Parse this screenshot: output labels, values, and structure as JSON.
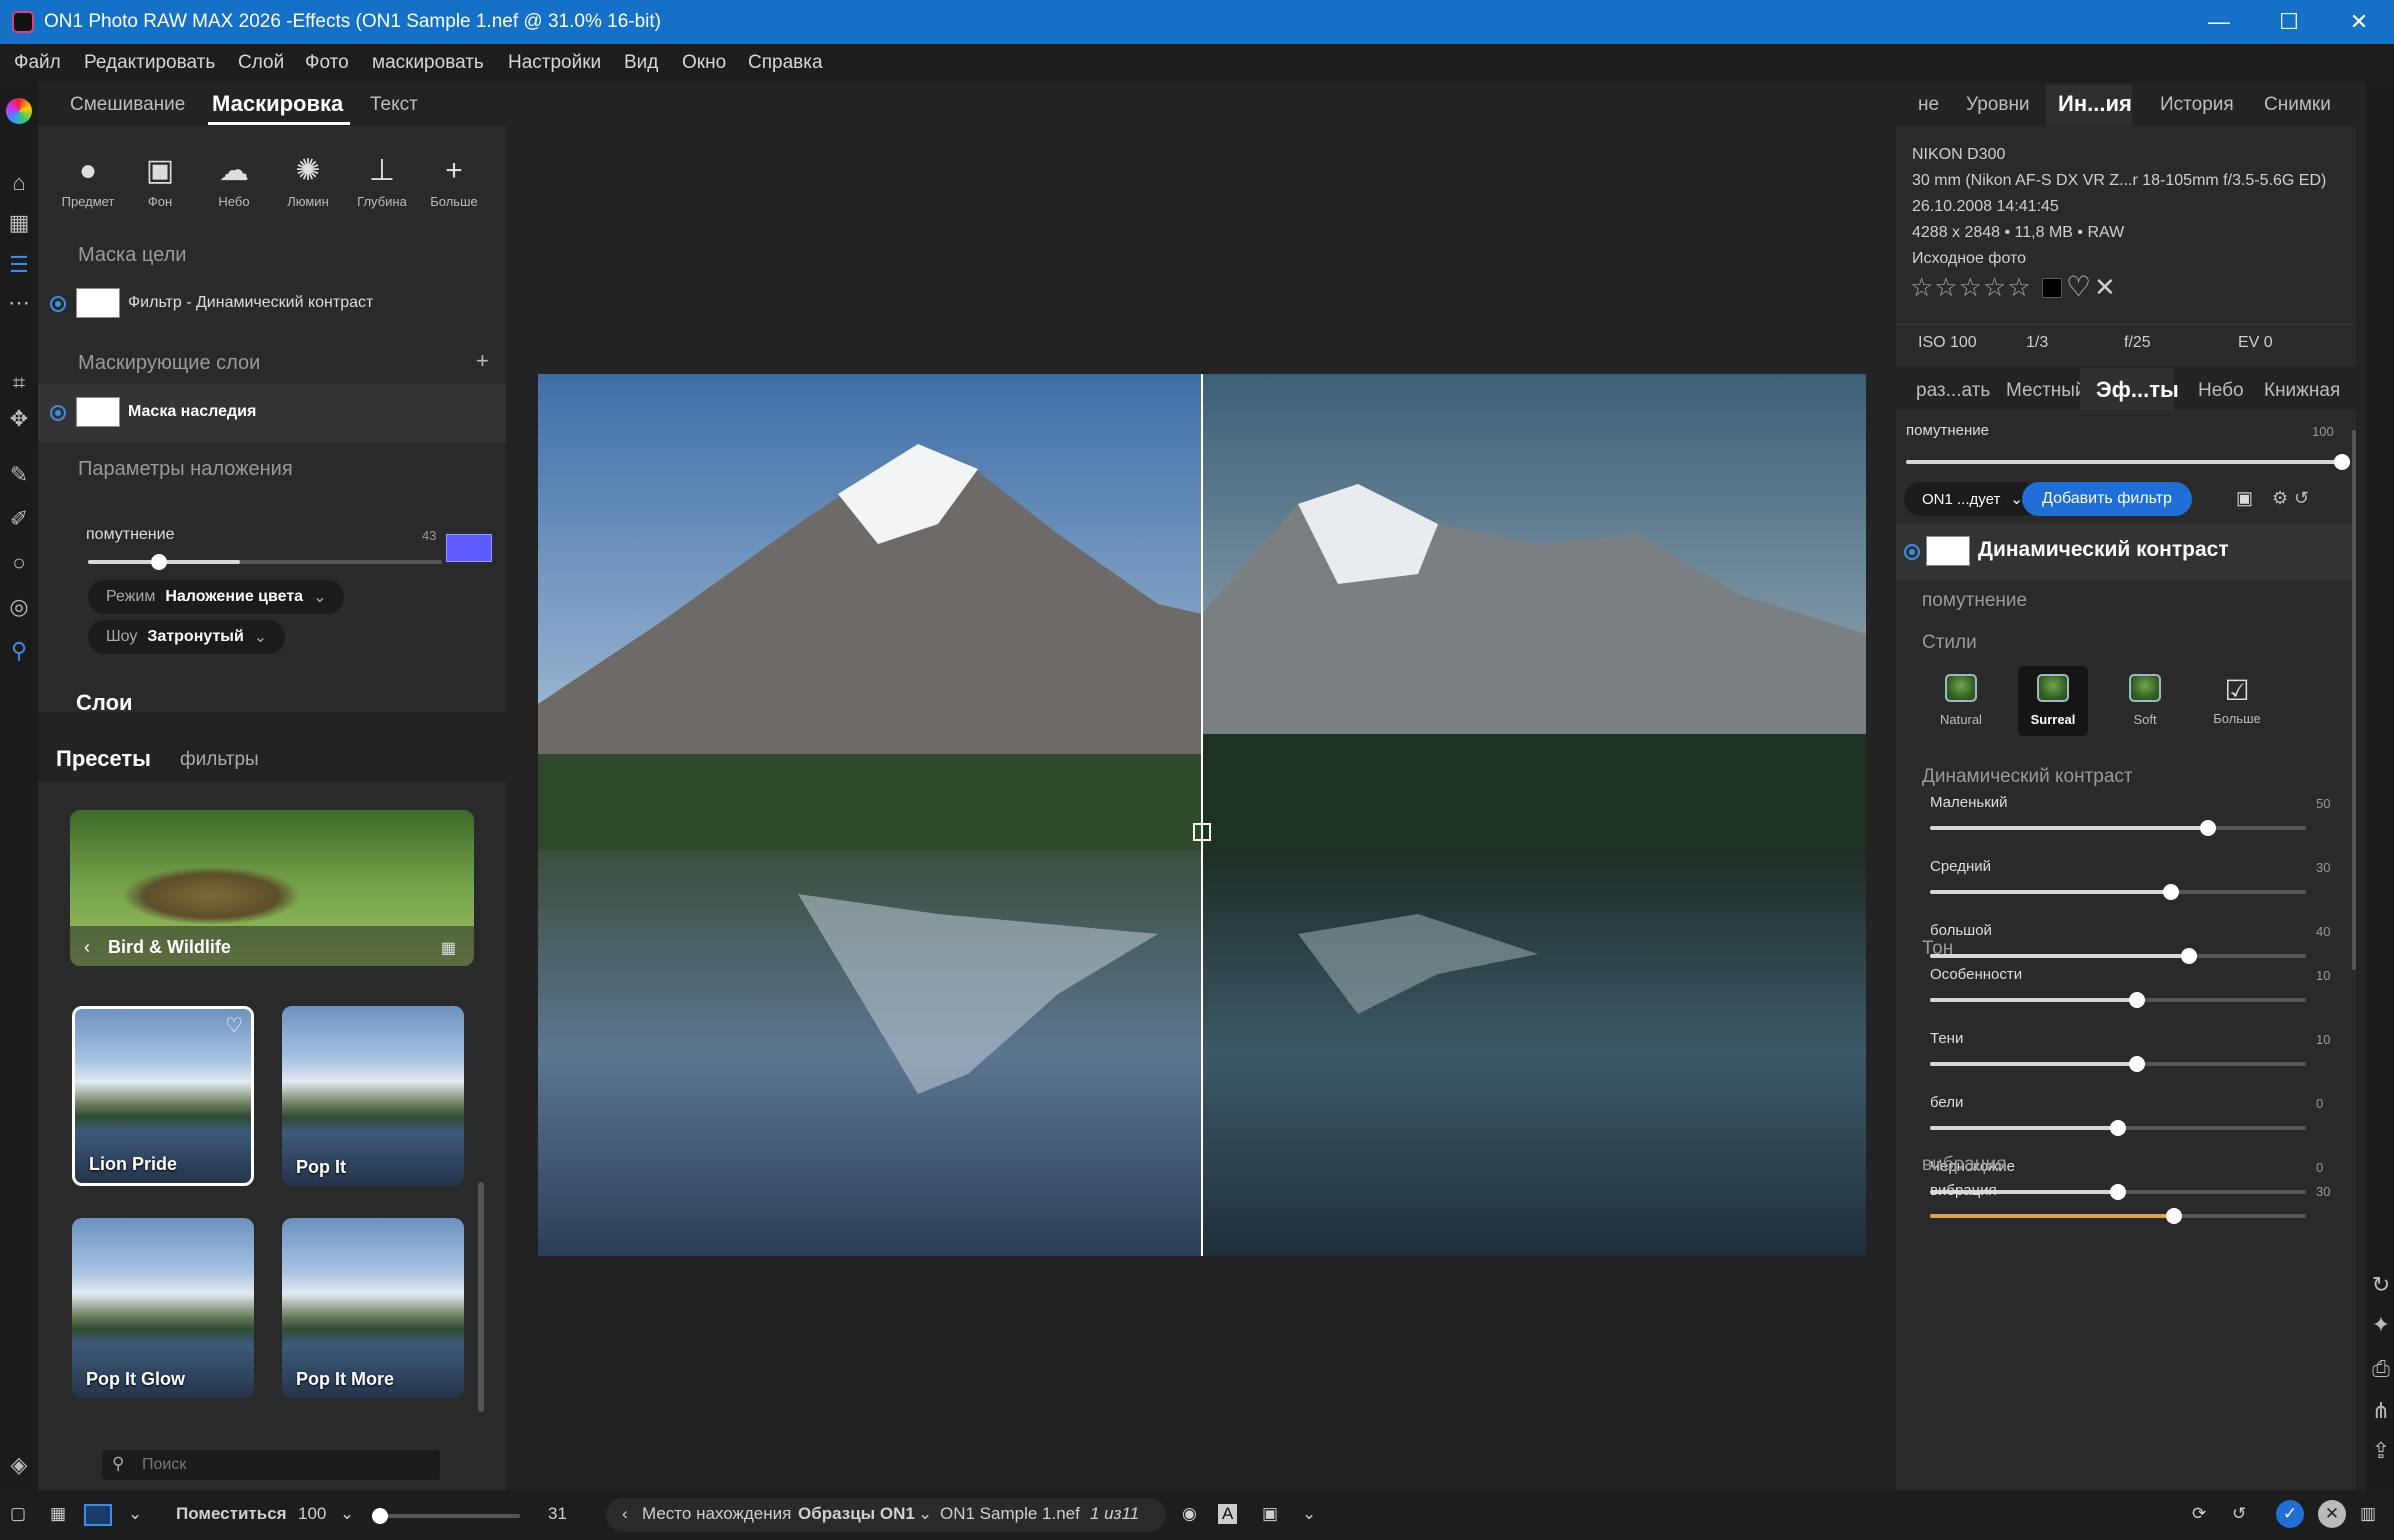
{
  "window": {
    "title": "ON1 Photo RAW MAX 2026 -Effects (ON1 Sample 1.nef @ 31.0% 16-bit)",
    "min": "—",
    "max": "☐",
    "close": "✕"
  },
  "menu": [
    "Файл",
    "Редактировать",
    "Слой",
    "Фото",
    "маскировать",
    "Настройки",
    "Вид",
    "Окно",
    "Справка"
  ],
  "left": {
    "tabs": [
      "Смешивание",
      "Маскировка",
      "Текст"
    ],
    "tools": [
      {
        "icon": "person-icon",
        "label": "Предмет"
      },
      {
        "icon": "portrait-icon",
        "label": "Фон"
      },
      {
        "icon": "cloud-sun-icon",
        "label": "Небо"
      },
      {
        "icon": "lighthouse-icon",
        "label": "Люмин"
      },
      {
        "icon": "depth-icon",
        "label": "Глубина"
      },
      {
        "icon": "plus-icon",
        "label": "Больше"
      }
    ],
    "target_mask_heading": "Маска цели",
    "filter_row": "Фильтр - Динамический контраст",
    "mask_layers_heading": "Маскирующие слои",
    "add": "+",
    "legacy_mask": "Маска наследия",
    "overlay_heading": "Параметры наложения",
    "opacity_label": "помутнение",
    "opacity_value": "43",
    "overlay_color": "#5b5bff",
    "mode_label": "Режим",
    "mode_value": "Наложение цвета",
    "show_label": "Шоу",
    "show_value": "Затронутый",
    "layers_heading": "Слои",
    "preset_tabs": [
      "Пресеты",
      "фильтры"
    ],
    "category": "Bird & Wildlife",
    "presets": [
      "Lion Pride",
      "Pop It",
      "Pop It Glow",
      "Pop It More"
    ],
    "search_placeholder": "Поиск"
  },
  "right": {
    "tabs": [
      "не",
      "Уровни",
      "Ин...ия",
      "История",
      "Снимки"
    ],
    "info": [
      "NIKON D300",
      "30 mm (Nikon AF-S DX VR Z...r 18-105mm f/3.5-5.6G ED)",
      "26.10.2008 14:41:45",
      "4288 x 2848 • 11,8 MB • RAW",
      "Исходное фото"
    ],
    "exif": [
      "ISO 100",
      "1/3",
      "f/25",
      "EV 0"
    ],
    "edit_tabs": [
      "раз...ать",
      "Местный",
      "Эф...ты",
      "Небо",
      "Книжная"
    ],
    "opacity_label": "помутнение",
    "opacity_value": "100",
    "preset_dropdown": "ON1 ...дует",
    "add_filter": "Добавить фильтр",
    "filter_title": "Динамический контраст",
    "filter_opacity": "помутнение",
    "styles_heading": "Стили",
    "styles": [
      "Natural",
      "Surreal",
      "Soft",
      "Больше"
    ],
    "dc_heading": "Динамический контраст",
    "dc_sliders": [
      {
        "label": "Маленький",
        "value": "50",
        "frac": 0.74
      },
      {
        "label": "Средний",
        "value": "30",
        "frac": 0.64
      },
      {
        "label": "большой",
        "value": "40",
        "frac": 0.69
      }
    ],
    "tone_heading": "Тон",
    "tone_sliders": [
      {
        "label": "Особенности",
        "value": "10",
        "frac": 0.55
      },
      {
        "label": "Тени",
        "value": "10",
        "frac": 0.55
      },
      {
        "label": "бели",
        "value": "0",
        "frac": 0.5
      },
      {
        "label": "Чернокожие",
        "value": "0",
        "frac": 0.5
      }
    ],
    "vib_heading": "вибрация",
    "vib_sliders": [
      {
        "label": "вибрация",
        "value": "30",
        "frac": 0.65
      }
    ]
  },
  "bottom": {
    "fit": "Поместиться",
    "zoom": "100",
    "size": "31",
    "location_label": "Место нахождения",
    "location": "Образцы ON1",
    "file": "ON1 Sample 1.nef",
    "count": "1 из11"
  }
}
